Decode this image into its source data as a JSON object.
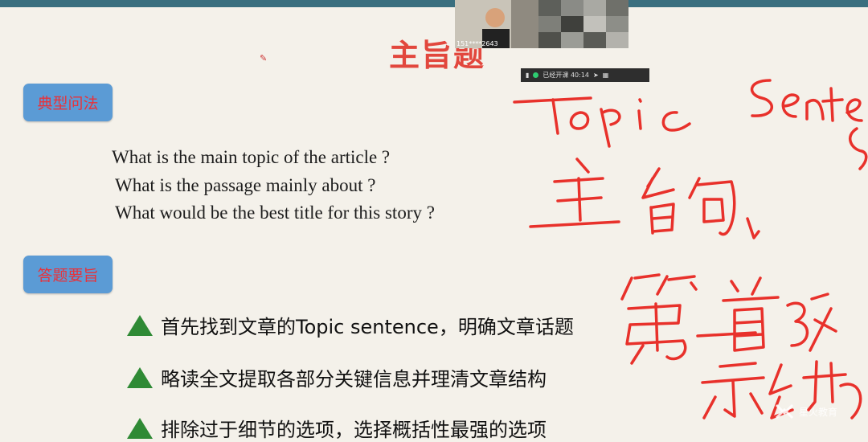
{
  "slide": {
    "title": "主旨题",
    "badge_typical": "典型问法",
    "badge_tips": "答题要旨",
    "questions": [
      "What is the main topic of the article ?",
      "What is the passage mainly about ?",
      "What would be the best title for this story ?"
    ],
    "bullets": [
      "首先找到文章的Topic sentence，明确文章话题",
      "略读全文提取各部分关键信息并理清文章结构",
      "排除过于细节的选项，选择概括性最强的选项"
    ]
  },
  "meeting": {
    "participant_label": "151****2643",
    "status_text": "已经开课 40:14"
  },
  "annotation": {
    "handwriting_1": "Topic Sentence",
    "handwriting_2": "主旨句",
    "handwriting_3": "第一首段",
    "handwriting_4": "示结构"
  },
  "watermark": {
    "text": "星火教育"
  },
  "colors": {
    "title_red": "#e2473d",
    "badge_blue": "#5b9bd5",
    "ink_red": "#e8312b",
    "triangle_green": "#2f8a35"
  }
}
